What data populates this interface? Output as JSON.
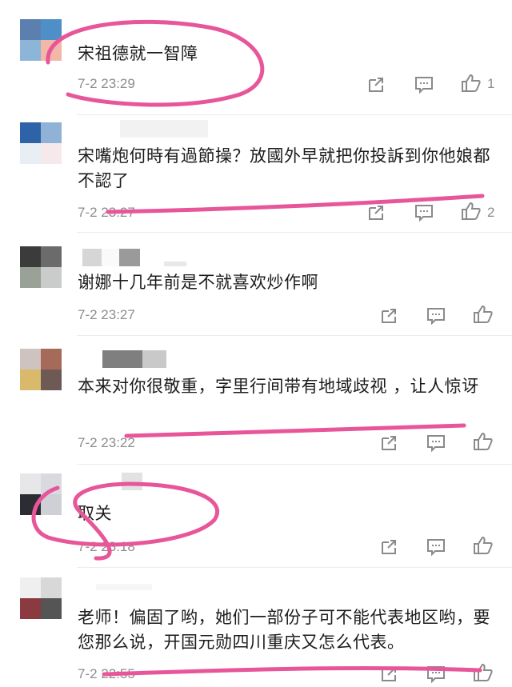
{
  "colors": {
    "highlight": "#e8569a",
    "meta_text": "#8d8d8d",
    "body_text": "#1c1c1c"
  },
  "icons": {
    "share": "share-icon",
    "reply": "reply-icon",
    "like": "thumbs-up-icon"
  },
  "comments": [
    {
      "text": "宋祖德就一智障",
      "time": "7-2 23:29",
      "likes": "1"
    },
    {
      "text": "宋嘴炮何時有過節操？放國外早就把你投訴到你他娘都不認了",
      "time": "7-2 23:27",
      "likes": "2"
    },
    {
      "text": "谢娜十几年前是不就喜欢炒作啊",
      "time": "7-2 23:27",
      "likes": ""
    },
    {
      "text": "本来对你很敬重，字里行间带有地域歧视 ，让人惊讶",
      "time": "7-2 23:22",
      "likes": ""
    },
    {
      "text": "取关",
      "time": "7-2 23:18",
      "likes": ""
    },
    {
      "text": "老师！偏固了哟，她们一部份子可不能代表地区哟，要您那么说，开国元勋四川重庆又怎么代表。",
      "time": "7-2 22:55",
      "likes": ""
    }
  ]
}
